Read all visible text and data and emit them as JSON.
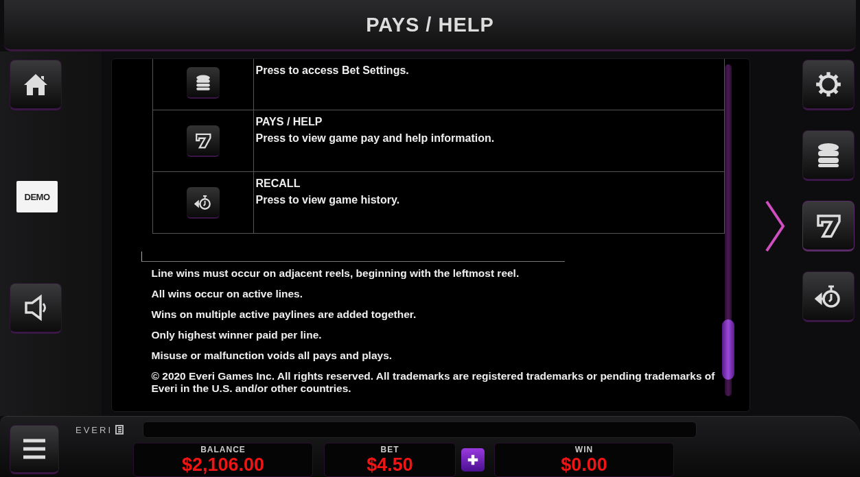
{
  "header": {
    "title": "PAYS / HELP"
  },
  "left_buttons": [
    {
      "kind": "home"
    },
    {
      "kind": "demo",
      "label": "DEMO"
    },
    {
      "kind": "sound"
    }
  ],
  "right_buttons": [
    {
      "kind": "settings",
      "selected": false
    },
    {
      "kind": "bet",
      "selected": false
    },
    {
      "kind": "pays",
      "selected": true
    },
    {
      "kind": "recall",
      "selected": false
    }
  ],
  "help_table": [
    {
      "kind": "bet",
      "description": "Press to access Bet Settings."
    },
    {
      "kind": "pays",
      "title": "PAYS / HELP",
      "description": "Press to view game pay and help information."
    },
    {
      "kind": "recall",
      "title": "RECALL",
      "description": "Press to view game history."
    }
  ],
  "rules": [
    "Line wins must occur on adjacent reels, beginning with the leftmost reel.",
    "All wins occur on active lines.",
    "Wins on multiple active paylines are added together.",
    "Only highest winner paid per line.",
    "Misuse or malfunction voids all pays and plays.",
    "© 2020 Everi Games Inc. All rights reserved. All trademarks are registered trademarks or pending trademarks of Everi in the U.S. and/or other countries."
  ],
  "footer": {
    "brand": "EVERI",
    "meters": [
      {
        "label": "BALANCE",
        "value": "$2,106.00"
      },
      {
        "label": "BET",
        "value": "$4.50",
        "kind": "bet"
      },
      {
        "label": "WIN",
        "value": "$0.00"
      }
    ]
  }
}
